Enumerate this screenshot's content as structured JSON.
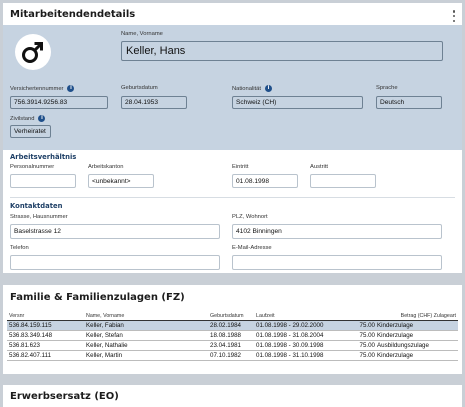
{
  "details": {
    "title": "Mitarbeitendendetails",
    "name_label": "Name, Vorname",
    "name_value": "Keller, Hans",
    "ahv_label": "Versichertennummer",
    "ahv_value": "756.3914.9256.83",
    "birth_label": "Geburtsdatum",
    "birth_value": "28.04.1953",
    "nationality_label": "Nationalität",
    "nationality_value": "Schweiz (CH)",
    "language_label": "Sprache",
    "language_value": "Deutsch",
    "civil_label": "Zivilstand",
    "civil_value": "Verheiratet",
    "info_glyph": "i",
    "gender_icon": "male-symbol-icon"
  },
  "employment": {
    "title": "Arbeitsverhältnis",
    "personnel_label": "Personalnummer",
    "personnel_value": "",
    "canton_label": "Arbeitskanton",
    "canton_value": "<unbekannt>",
    "entry_label": "Eintritt",
    "entry_value": "01.08.1998",
    "exit_label": "Austritt",
    "exit_value": ""
  },
  "contact": {
    "title": "Kontaktdaten",
    "street_label": "Strasse, Hausnummer",
    "street_value": "Baselstrasse 12",
    "zip_label": "PLZ, Wohnort",
    "zip_value": "4102 Binningen",
    "phone_label": "Telefon",
    "phone_value": "",
    "email_label": "E-Mail-Adresse",
    "email_value": ""
  },
  "family": {
    "title": "Familie & Familienzulagen (FZ)",
    "headers": [
      "Versnr",
      "Name, Vorname",
      "Geburtsdatum",
      "Laufzeit",
      "Betrag (CHF) Zulageart"
    ],
    "rows": [
      {
        "versnr": "536.84.159.115",
        "name": "Keller, Fabian",
        "birth": "28.02.1984",
        "period": "01.08.1998 - 29.02.2000",
        "amount": "75.00",
        "type": "Kinderzulage"
      },
      {
        "versnr": "536.83.349.148",
        "name": "Keller, Stefan",
        "birth": "18.08.1988",
        "period": "01.08.1998 - 31.08.2004",
        "amount": "75.00",
        "type": "Kinderzulage"
      },
      {
        "versnr": "536.81.623",
        "name": "Keller, Nathalie",
        "birth": "23.04.1981",
        "period": "01.08.1998 - 30.09.1998",
        "amount": "75.00",
        "type": "Ausbildungszulage"
      },
      {
        "versnr": "536.82.407.111",
        "name": "Keller, Martin",
        "birth": "07.10.1982",
        "period": "01.08.1998 - 31.10.1998",
        "amount": "75.00",
        "type": "Kinderzulage"
      }
    ]
  },
  "eo": {
    "title": "Erwerbsersatz (EO)"
  },
  "colors": {
    "panel": "#c6d3e1",
    "accent": "#1f4f8a",
    "section_title": "#1e3f66"
  }
}
